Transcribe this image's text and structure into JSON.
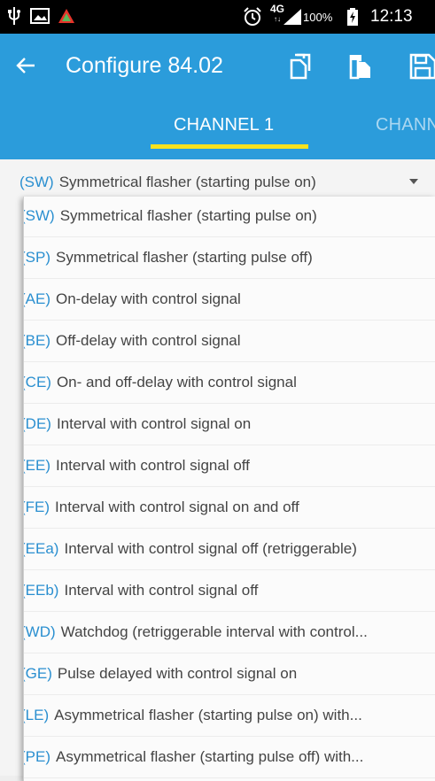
{
  "status_bar": {
    "icons": [
      "usb-icon",
      "image-icon",
      "warning-icon",
      "alarm-icon",
      "signal-icon",
      "battery-icon"
    ],
    "network_top": "4G",
    "network_bottom": "↑↓",
    "battery": "100%",
    "time": "12:13"
  },
  "app_bar": {
    "title": "Configure 84.02",
    "back_icon": "arrow-back-icon",
    "actions": [
      "copy-icon",
      "paste-icon",
      "save-icon"
    ],
    "background": "#2b9cdb"
  },
  "tabs": [
    {
      "label": "CHANNEL 1",
      "selected": true
    },
    {
      "label": "CHANN",
      "selected": false
    }
  ],
  "tab_indicator_color": "#f7e21e",
  "spinner": {
    "code": "(SW)",
    "label": "Symmetrical flasher (starting pulse on)"
  },
  "options": [
    {
      "code": "(SW)",
      "label": "Symmetrical flasher (starting pulse on)"
    },
    {
      "code": "(SP)",
      "label": "Symmetrical flasher (starting pulse off)"
    },
    {
      "code": "(AE)",
      "label": "On-delay with control signal"
    },
    {
      "code": "(BE)",
      "label": "Off-delay with control signal"
    },
    {
      "code": "(CE)",
      "label": "On- and off-delay with control signal"
    },
    {
      "code": "(DE)",
      "label": "Interval with control signal on"
    },
    {
      "code": "(EE)",
      "label": "Interval with control signal off"
    },
    {
      "code": "(FE)",
      "label": "Interval with control signal on and off"
    },
    {
      "code": "(EEa)",
      "label": "Interval with control signal off (retriggerable)"
    },
    {
      "code": "(EEb)",
      "label": "Interval with control signal off"
    },
    {
      "code": "(WD)",
      "label": "Watchdog (retriggerable interval with control..."
    },
    {
      "code": "(GE)",
      "label": "Pulse delayed with control signal on"
    },
    {
      "code": "(LE)",
      "label": "Asymmetrical flasher (starting pulse on) with..."
    },
    {
      "code": "(PE)",
      "label": "Asymmetrical flasher (starting pulse off) with..."
    }
  ],
  "code_color": "#2a8fd0"
}
